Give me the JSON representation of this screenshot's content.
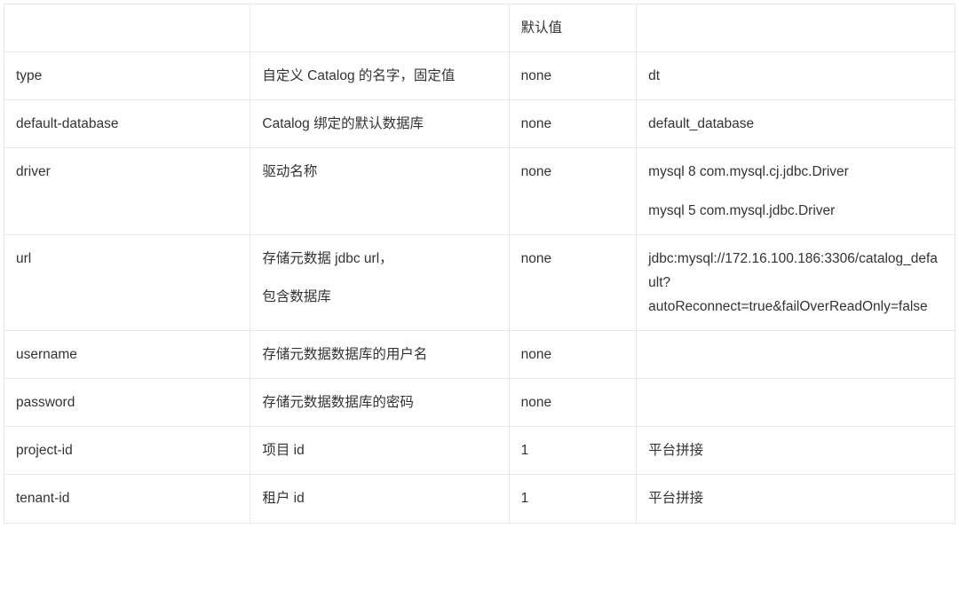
{
  "table": {
    "headers": {
      "c0": "",
      "c1": "",
      "c2": "默认值",
      "c3": ""
    },
    "rows": [
      {
        "name": "type",
        "desc": "自定义 Catalog 的名字，固定值",
        "default": "none",
        "example": "dt"
      },
      {
        "name": "default-database",
        "desc": "Catalog 绑定的默认数据库",
        "default": "none",
        "example": "default_database"
      },
      {
        "name": "driver",
        "desc": "驱动名称",
        "default": "none",
        "example_lines": [
          "mysql 8 com.mysql.cj.jdbc.Driver",
          "mysql 5 com.mysql.jdbc.Driver"
        ]
      },
      {
        "name": "url",
        "desc_lines": [
          "存储元数据 jdbc url，",
          "包含数据库"
        ],
        "default": "none",
        "example": "jdbc:mysql://172.16.100.186:3306/catalog_default?autoReconnect=true&failOverReadOnly=false"
      },
      {
        "name": "username",
        "desc": "存储元数据数据库的用户名",
        "default": "none",
        "example": ""
      },
      {
        "name": "password",
        "desc": "存储元数据数据库的密码",
        "default": "none",
        "example": ""
      },
      {
        "name": "project-id",
        "desc": "项目 id",
        "default": "1",
        "example": "平台拼接"
      },
      {
        "name": "tenant-id",
        "desc": "租户 id",
        "default": "1",
        "example": "平台拼接"
      }
    ]
  }
}
